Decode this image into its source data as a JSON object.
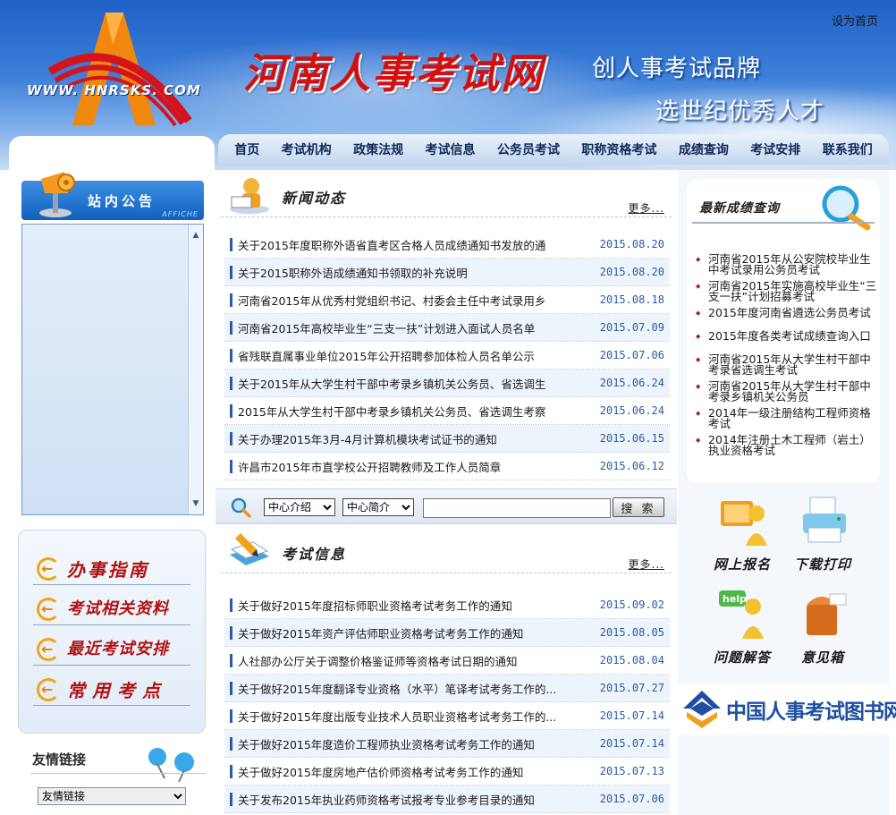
{
  "header": {
    "set_home": "设为首页",
    "logo_url": "WWW. HNRSKS. COM",
    "site_title": "河南人事考试网",
    "slogan_1": "创人事考试品牌",
    "slogan_2": "选世纪优秀人才"
  },
  "nav": [
    "首页",
    "考试机构",
    "政策法规",
    "考试信息",
    "公务员考试",
    "职称资格考试",
    "成绩查询",
    "考试安排",
    "联系我们"
  ],
  "notice": {
    "title": "站内公告",
    "subtitle": "AFFICHE"
  },
  "guide": [
    "办事指南",
    "考试相关资料",
    "最近考试安排",
    "常用考点"
  ],
  "links": {
    "title": "友情链接",
    "select_value": "友情链接"
  },
  "news": {
    "title": "新闻动态",
    "more": "更多...",
    "items": [
      {
        "title": "关于2015年度职称外语省直考区合格人员成绩通知书发放的通",
        "date": "2015.08.20"
      },
      {
        "title": "关于2015职称外语成绩通知书领取的补充说明",
        "date": "2015.08.20"
      },
      {
        "title": "河南省2015年从优秀村党组织书记、村委会主任中考试录用乡",
        "date": "2015.08.18"
      },
      {
        "title": "河南省2015年高校毕业生“三支一扶”计划进入面试人员名单",
        "date": "2015.07.09"
      },
      {
        "title": "省残联直属事业单位2015年公开招聘参加体检人员名单公示",
        "date": "2015.07.06"
      },
      {
        "title": "关于2015年从大学生村干部中考录乡镇机关公务员、省选调生",
        "date": "2015.06.24"
      },
      {
        "title": "2015年从大学生村干部中考录乡镇机关公务员、省选调生考察",
        "date": "2015.06.24"
      },
      {
        "title": "关于办理2015年3月-4月计算机模块考试证书的通知",
        "date": "2015.06.15"
      },
      {
        "title": "许昌市2015年市直学校公开招聘教师及工作人员简章",
        "date": "2015.06.12"
      }
    ]
  },
  "search": {
    "select1": "中心介绍",
    "select2": "中心简介",
    "input_value": "",
    "button": "搜 索"
  },
  "exam_info": {
    "title": "考试信息",
    "more": "更多...",
    "items": [
      {
        "title": "关于做好2015年度招标师职业资格考试考务工作的通知",
        "date": "2015.09.02"
      },
      {
        "title": "关于做好2015年资产评估师职业资格考试考务工作的通知",
        "date": "2015.08.05"
      },
      {
        "title": "人社部办公厅关于调整价格鉴证师等资格考试日期的通知",
        "date": "2015.08.04"
      },
      {
        "title": "关于做好2015年度翻译专业资格（水平）笔译考试考务工作的...",
        "date": "2015.07.27"
      },
      {
        "title": "关于做好2015年度出版专业技术人员职业资格考试考务工作的...",
        "date": "2015.07.14"
      },
      {
        "title": "关于做好2015年度造价工程师执业资格考试考务工作的通知",
        "date": "2015.07.14"
      },
      {
        "title": "关于做好2015年度房地产估价师资格考试考务工作的通知",
        "date": "2015.07.13"
      },
      {
        "title": "关于发布2015年执业药师资格考试报考专业参考目录的通知",
        "date": "2015.07.06"
      }
    ]
  },
  "scores": {
    "title": "最新成绩查询",
    "items": [
      "河南省2015年从公安院校毕业生中考试录用公务员考试",
      "河南省2015年实施高校毕业生“三支一扶”计划招募考试",
      "2015年度河南省遴选公务员考试",
      "2015年度各类考试成绩查询入口",
      "河南省2015年从大学生村干部中考录省选调生考试",
      "河南省2015年从大学生村干部中考录乡镇机关公务员",
      "2014年一级注册结构工程师资格考试",
      "2014年注册土木工程师（岩土）执业资格考试"
    ]
  },
  "tiles": [
    {
      "label": "网上报名",
      "icon": "online-registration-icon"
    },
    {
      "label": "下载打印",
      "icon": "printer-icon"
    },
    {
      "label": "问题解答",
      "icon": "help-icon"
    },
    {
      "label": "意见箱",
      "icon": "suggestion-box-icon"
    }
  ],
  "books_banner": "中国人事考试图书网",
  "colors": {
    "brand_red": "#d21010",
    "nav_blue": "#1f60c6",
    "date_blue": "#2a5aa7"
  }
}
